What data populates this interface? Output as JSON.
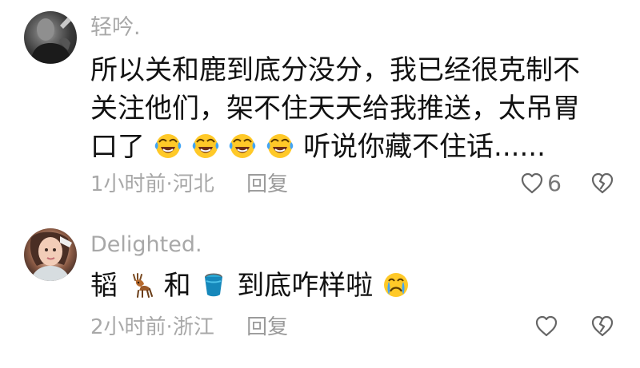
{
  "comments": [
    {
      "username": "轻吟.",
      "lines": [
        "所以关和鹿到底分没分，我已经很克制不",
        "关注他们，架不住天天给我推送，太吊胃",
        "口了",
        "听说你藏不住话......"
      ],
      "emoji_sequence": [
        "laughing-tears-emoji",
        "laughing-tears-emoji",
        "laughing-tears-emoji",
        "laughing-tears-emoji"
      ],
      "time": "1小时前",
      "location": "河北",
      "reply_label": "回复",
      "like_count": "6"
    },
    {
      "username": "Delighted.",
      "text_before": "韬",
      "emoji_1": "deer-emoji",
      "text_middle": "和",
      "emoji_2": "bucket-emoji",
      "text_after": "到底咋样啦",
      "emoji_3": "crying-face-emoji",
      "time": "2小时前",
      "location": "浙江",
      "reply_label": "回复",
      "like_count": ""
    }
  ]
}
